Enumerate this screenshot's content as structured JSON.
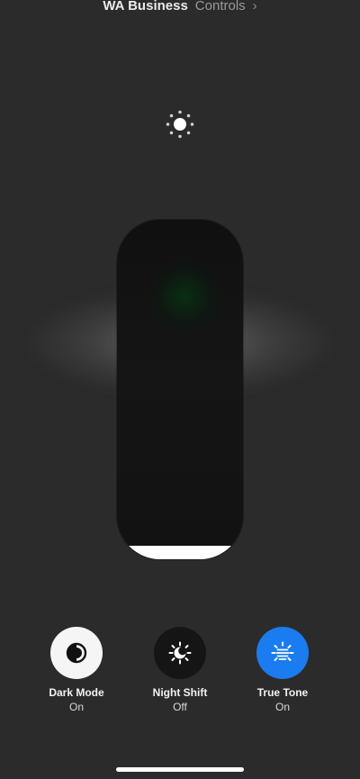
{
  "header": {
    "app_name": "WA Business",
    "controls_label": "Controls",
    "chevron": "›"
  },
  "brightness": {
    "icon": "sun-icon",
    "level": 0.04
  },
  "toggles": [
    {
      "icon": "dark-mode-icon",
      "label": "Dark Mode",
      "state": "On",
      "color": "#f5f5f5"
    },
    {
      "icon": "night-shift-icon",
      "label": "Night Shift",
      "state": "Off",
      "color": "#151515"
    },
    {
      "icon": "true-tone-icon",
      "label": "True Tone",
      "state": "On",
      "color": "#1a7cf0"
    }
  ],
  "colors": {
    "background": "#2b2b2b",
    "slider_fill": "#ffffff",
    "accent": "#1a7cf0"
  }
}
